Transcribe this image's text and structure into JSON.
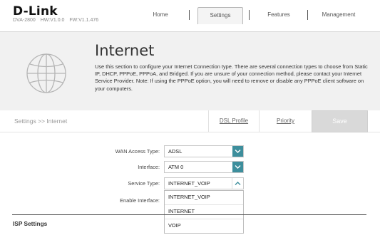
{
  "header": {
    "brand": "D-Link",
    "model": {
      "name": "DVA-2800",
      "hw": "HW:V1.0.0",
      "fw": "FW:V1.1.476"
    },
    "nav": {
      "home": "Home",
      "settings": "Settings",
      "features": "Features",
      "management": "Management"
    },
    "active_tab": "Settings"
  },
  "banner": {
    "title": "Internet",
    "description": "Use this section to configure your Internet Connection type. There are several connection types to choose from Static IP, DHCP, PPPoE, PPPoA, and Bridged. If you are unsure of your connection method, please contact your Internet Service Provider. Note: If using the PPPoE option, you will need to remove or disable any PPPoE client software on your computers.",
    "icon": "globe-icon"
  },
  "subbar": {
    "breadcrumb": "Settings >> Internet",
    "dsl_profile": "DSL Profile",
    "priority": "Priority",
    "save": "Save"
  },
  "form": {
    "wan_access_type": {
      "label": "WAN Access Type:",
      "value": "ADSL"
    },
    "interface": {
      "label": "Interface:",
      "value": "ATM 0"
    },
    "service_type": {
      "label": "Service Type:",
      "value": "INTERNET_VOIP",
      "options": [
        "INTERNET_VOIP",
        "INTERNET",
        "VOIP"
      ]
    },
    "enable_interface": {
      "label": "Enable Interface:"
    }
  },
  "sections": {
    "isp_settings": "ISP Settings"
  },
  "colors": {
    "accent": "#3d8e9c",
    "banner_bg": "#f1f1f1",
    "save_disabled": "#d9d9d9"
  }
}
